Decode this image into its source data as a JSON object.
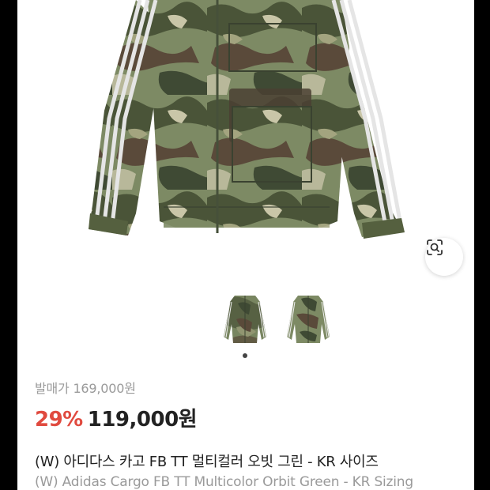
{
  "product": {
    "original_price_label": "발매가 169,000원",
    "discount": "29%",
    "price": "119,000원",
    "title_ko": "(W) 아디다스 카고 FB TT 멀티컬러 오빗 그린 - KR 사이즈",
    "title_en": "(W) Adidas Cargo FB TT Multicolor Orbit Green - KR Sizing"
  },
  "gallery": {
    "thumbnail_count": 2,
    "active_index": 0
  },
  "colors": {
    "discount": "#e04a3f",
    "price": "#222222",
    "muted": "#9a9a9a",
    "camo_base": "#7d8a64",
    "camo_dark": "#3f4a34",
    "camo_brown": "#5a4a3a"
  },
  "icons": {
    "lens": "lens-search-icon"
  }
}
